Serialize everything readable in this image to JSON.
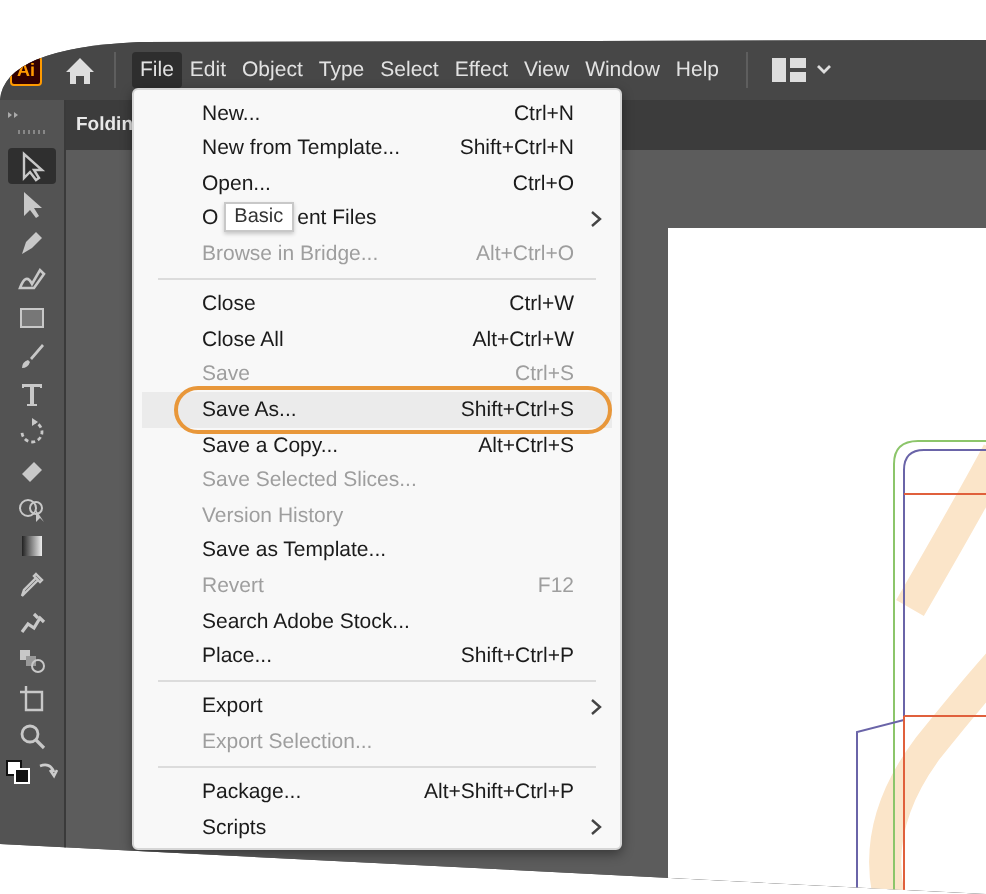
{
  "app_logo": "Ai",
  "menu_bar": [
    {
      "label": "File",
      "selected": true
    },
    {
      "label": "Edit",
      "selected": false
    },
    {
      "label": "Object",
      "selected": false
    },
    {
      "label": "Type",
      "selected": false
    },
    {
      "label": "Select",
      "selected": false
    },
    {
      "label": "Effect",
      "selected": false
    },
    {
      "label": "View",
      "selected": false
    },
    {
      "label": "Window",
      "selected": false
    },
    {
      "label": "Help",
      "selected": false
    }
  ],
  "document_tab": {
    "title": "Foldin"
  },
  "tools": [
    {
      "selected": true
    },
    {
      "selected": false
    },
    {
      "selected": false
    },
    {
      "selected": false
    },
    {
      "selected": false
    },
    {
      "selected": false
    },
    {
      "selected": false
    },
    {
      "selected": false
    },
    {
      "selected": false
    },
    {
      "selected": false
    },
    {
      "selected": false
    },
    {
      "selected": false
    },
    {
      "selected": false
    },
    {
      "selected": false
    },
    {
      "selected": false
    },
    {
      "selected": false
    }
  ],
  "file_menu": [
    {
      "kind": "item",
      "label": "New...",
      "shortcut": "Ctrl+N",
      "disabled": false,
      "submenu": false,
      "highlighted": false
    },
    {
      "kind": "item",
      "label": "New from Template...",
      "shortcut": "Shift+Ctrl+N",
      "disabled": false,
      "submenu": false,
      "highlighted": false
    },
    {
      "kind": "item",
      "label": "Open...",
      "shortcut": "Ctrl+O",
      "disabled": false,
      "submenu": false,
      "highlighted": false
    },
    {
      "kind": "item",
      "label": "O",
      "label_after": "ent Files",
      "tooltip": "Basic",
      "disabled": false,
      "submenu": true,
      "highlighted": false
    },
    {
      "kind": "item",
      "label": "Browse in Bridge...",
      "shortcut": "Alt+Ctrl+O",
      "disabled": true,
      "submenu": false,
      "highlighted": false
    },
    {
      "kind": "separator"
    },
    {
      "kind": "item",
      "label": "Close",
      "shortcut": "Ctrl+W",
      "disabled": false,
      "submenu": false,
      "highlighted": false
    },
    {
      "kind": "item",
      "label": "Close All",
      "shortcut": "Alt+Ctrl+W",
      "disabled": false,
      "submenu": false,
      "highlighted": false
    },
    {
      "kind": "item",
      "label": "Save",
      "shortcut": "Ctrl+S",
      "disabled": true,
      "submenu": false,
      "highlighted": false
    },
    {
      "kind": "item",
      "label": "Save As...",
      "shortcut": "Shift+Ctrl+S",
      "disabled": false,
      "submenu": false,
      "highlighted": true
    },
    {
      "kind": "item",
      "label": "Save a Copy...",
      "shortcut": "Alt+Ctrl+S",
      "disabled": false,
      "submenu": false,
      "highlighted": false
    },
    {
      "kind": "item",
      "label": "Save Selected Slices...",
      "disabled": true,
      "submenu": false,
      "highlighted": false
    },
    {
      "kind": "item",
      "label": "Version History",
      "disabled": true,
      "submenu": false,
      "highlighted": false
    },
    {
      "kind": "item",
      "label": "Save as Template...",
      "disabled": false,
      "submenu": false,
      "highlighted": false
    },
    {
      "kind": "item",
      "label": "Revert",
      "shortcut": "F12",
      "disabled": true,
      "submenu": false,
      "highlighted": false
    },
    {
      "kind": "item",
      "label": "Search Adobe Stock...",
      "disabled": false,
      "submenu": false,
      "highlighted": false
    },
    {
      "kind": "item",
      "label": "Place...",
      "shortcut": "Shift+Ctrl+P",
      "disabled": false,
      "submenu": false,
      "highlighted": false
    },
    {
      "kind": "separator"
    },
    {
      "kind": "item",
      "label": "Export",
      "disabled": false,
      "submenu": true,
      "highlighted": false
    },
    {
      "kind": "item",
      "label": "Export Selection...",
      "disabled": true,
      "submenu": false,
      "highlighted": false
    },
    {
      "kind": "separator"
    },
    {
      "kind": "item",
      "label": "Package...",
      "shortcut": "Alt+Shift+Ctrl+P",
      "disabled": false,
      "submenu": false,
      "highlighted": false
    },
    {
      "kind": "item",
      "label": "Scripts",
      "disabled": false,
      "submenu": true,
      "highlighted": false
    }
  ]
}
